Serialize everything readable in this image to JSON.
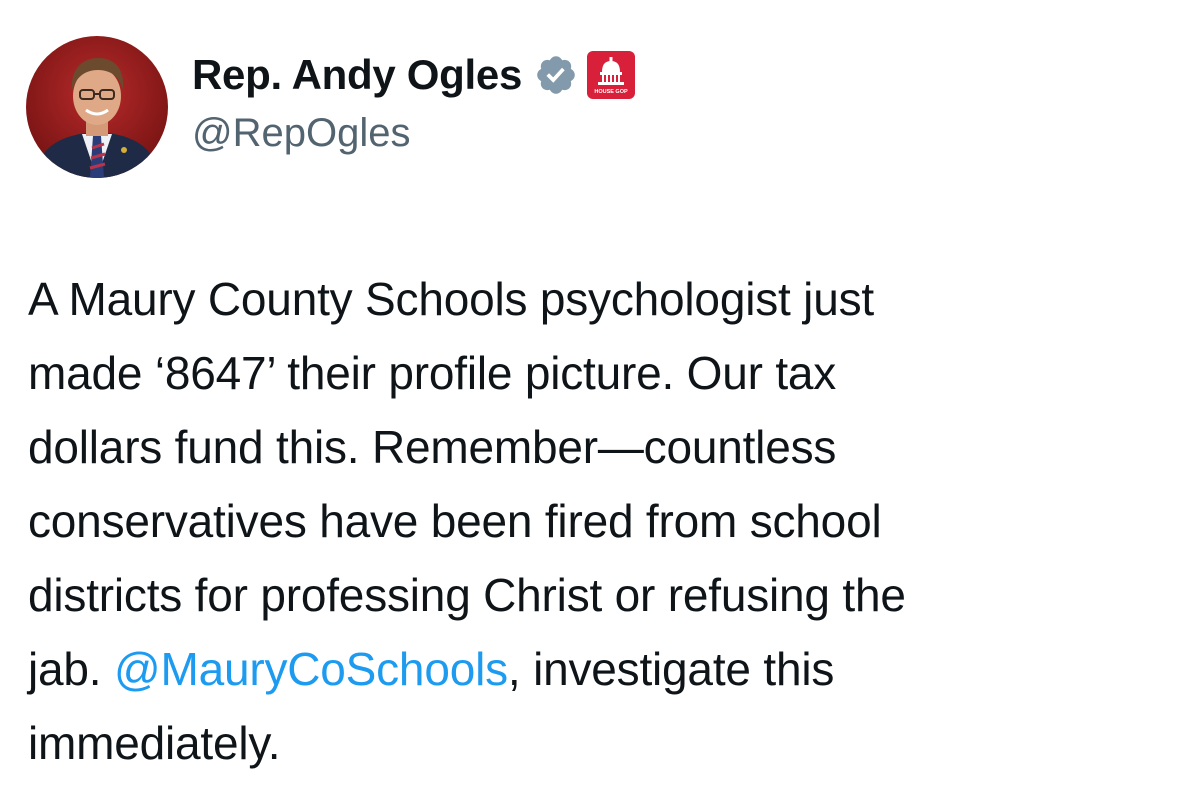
{
  "author": {
    "display_name": "Rep. Andy Ogles",
    "handle": "@RepOgles",
    "avatar": "avatar-photo",
    "verified_icon": "verified-badge-icon",
    "affiliation_icon": "house-gop-capitol-icon",
    "affiliation_badge_text": "HOUSE GOP"
  },
  "tweet": {
    "lines": {
      "l1": "A Maury County Schools psychologist just",
      "l2": "made ‘8647’ their profile picture. Our tax",
      "l3": "dollars fund this. Remember—countless",
      "l4": "conservatives have been fired from school",
      "l5": "districts for professing Christ or refusing the",
      "l6_prefix": "jab. ",
      "l6_mention": "@MauryCoSchools",
      "l6_suffix": ", investigate this",
      "l7": "immediately."
    }
  },
  "colors": {
    "text": "#0f1419",
    "secondary": "#536471",
    "link": "#1d9bf0",
    "verified_badge": "#829aab",
    "affiliate_red": "#d8203a"
  }
}
